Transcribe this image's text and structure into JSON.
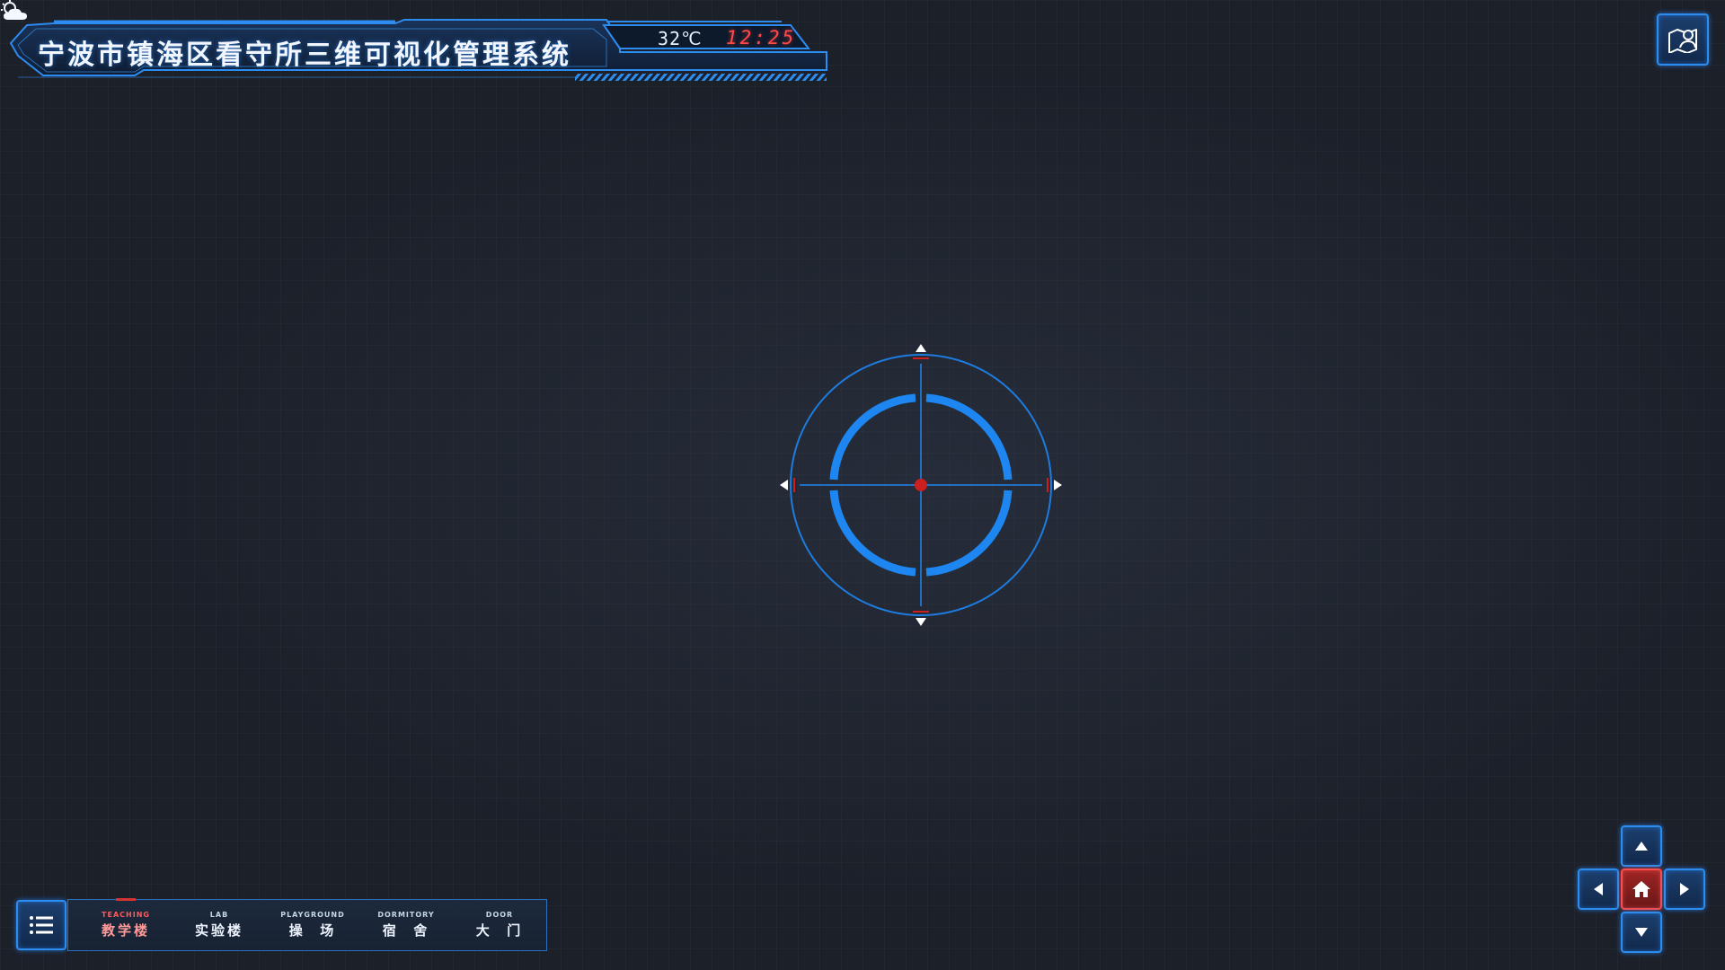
{
  "header": {
    "title": "宁波市镇海区看守所三维可视化管理系统",
    "weather_icon": "partly-cloudy-icon",
    "temperature": "32℃",
    "time": "12:25"
  },
  "toolbar": {
    "map_button_icon": "map-person-icon",
    "menu_button_icon": "list-menu-icon"
  },
  "nav": {
    "active_index": 0,
    "items": [
      {
        "en": "TEACHING",
        "cn": "教学楼"
      },
      {
        "en": "LAB",
        "cn": "实验楼"
      },
      {
        "en": "PLAYGROUND",
        "cn": "操  场"
      },
      {
        "en": "DORMITORY",
        "cn": "宿  舍"
      },
      {
        "en": "DOOR",
        "cn": "大  门"
      }
    ]
  },
  "dpad": {
    "up_icon": "arrow-up-icon",
    "left_icon": "arrow-left-icon",
    "home_icon": "home-icon",
    "right_icon": "arrow-right-icon",
    "down_icon": "arrow-down-icon"
  },
  "colors": {
    "accent": "#2d8cf0",
    "active": "#d63333",
    "crosshair_center": "#cc1f1f",
    "clock": "#ff4a4a"
  }
}
